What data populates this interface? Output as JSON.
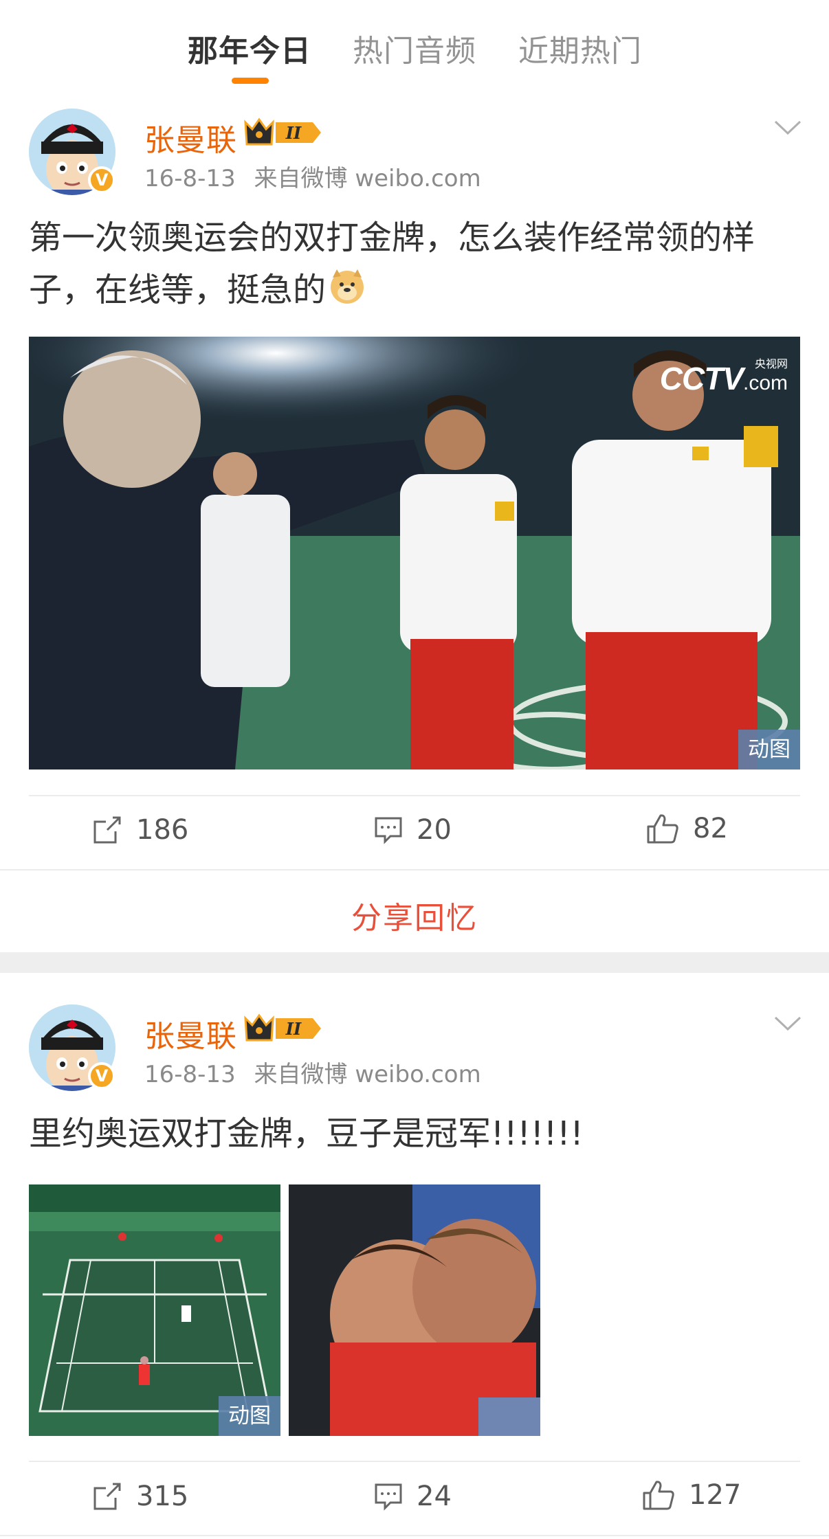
{
  "tabs": [
    {
      "label": "那年今日",
      "active": true
    },
    {
      "label": "热门音频",
      "active": false
    },
    {
      "label": "近期热门",
      "active": false
    }
  ],
  "posts": [
    {
      "username": "张曼联",
      "badge_level": "II",
      "verified_badge": "V",
      "timestamp": "16-8-13",
      "source": "来自微博 weibo.com",
      "text": "第一次领奥运会的双打金牌，怎么装作经常领的样子，在线等，挺急的",
      "emoji": "doge-emoji",
      "media_tag": "动图",
      "watermark_main": "CCTV",
      "watermark_sub": "央视网",
      "watermark_com": ".com",
      "reposts": "186",
      "comments": "20",
      "likes": "82",
      "share_memory": "分享回忆"
    },
    {
      "username": "张曼联",
      "badge_level": "II",
      "verified_badge": "V",
      "timestamp": "16-8-13",
      "source": "来自微博 weibo.com",
      "text": "里约奥运双打金牌，豆子是冠军!!!!!!!",
      "media_tag": "动图",
      "reposts": "315",
      "comments": "24",
      "likes": "127"
    }
  ],
  "colors": {
    "accent": "#ff8200",
    "username": "#e8650b",
    "share": "#e8503a",
    "meta": "#8a8a8a"
  }
}
